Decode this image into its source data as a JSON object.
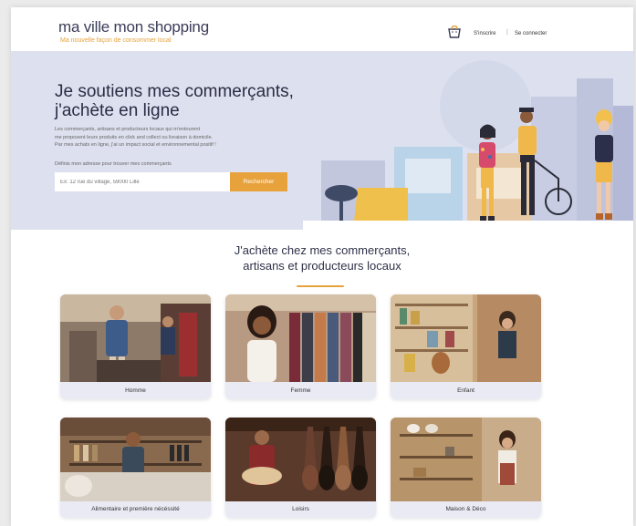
{
  "header": {
    "logo_text": "ma ville mon shopping",
    "tagline": "Ma nouvelle façon de consommer local",
    "register_label": "S'inscrire",
    "separator": "|",
    "login_label": "Se connecter"
  },
  "hero": {
    "title_line1": "Je soutiens mes commerçants,",
    "title_line2": "j'achète en ligne",
    "description_line1": "Les commerçants, artisans et producteurs locaux qui m'entourent",
    "description_line2": "me proposent leurs produits en click and collect ou livraison à domicile.",
    "description_line3": "Par mes achats en ligne, j'ai un impact social et environnemental positif !",
    "search_label": "Définis mon adresse pour trouver mes commerçants",
    "search_placeholder": "Ex: 12 rue du village, 59000 Lille",
    "search_button": "Rechercher"
  },
  "section": {
    "title_line1": "J'achète chez mes commerçants,",
    "title_line2": "artisans et producteurs locaux"
  },
  "categories": [
    {
      "label": "Homme"
    },
    {
      "label": "Femme"
    },
    {
      "label": "Enfant"
    },
    {
      "label": "Alimentaire et première nécéssité"
    },
    {
      "label": "Loisirs"
    },
    {
      "label": "Maison & Déco"
    }
  ],
  "colors": {
    "accent": "#e8a23b",
    "hero_bg": "#dde0ee",
    "heading": "#2a2c45",
    "card_label_bg": "#e9eaf4"
  }
}
